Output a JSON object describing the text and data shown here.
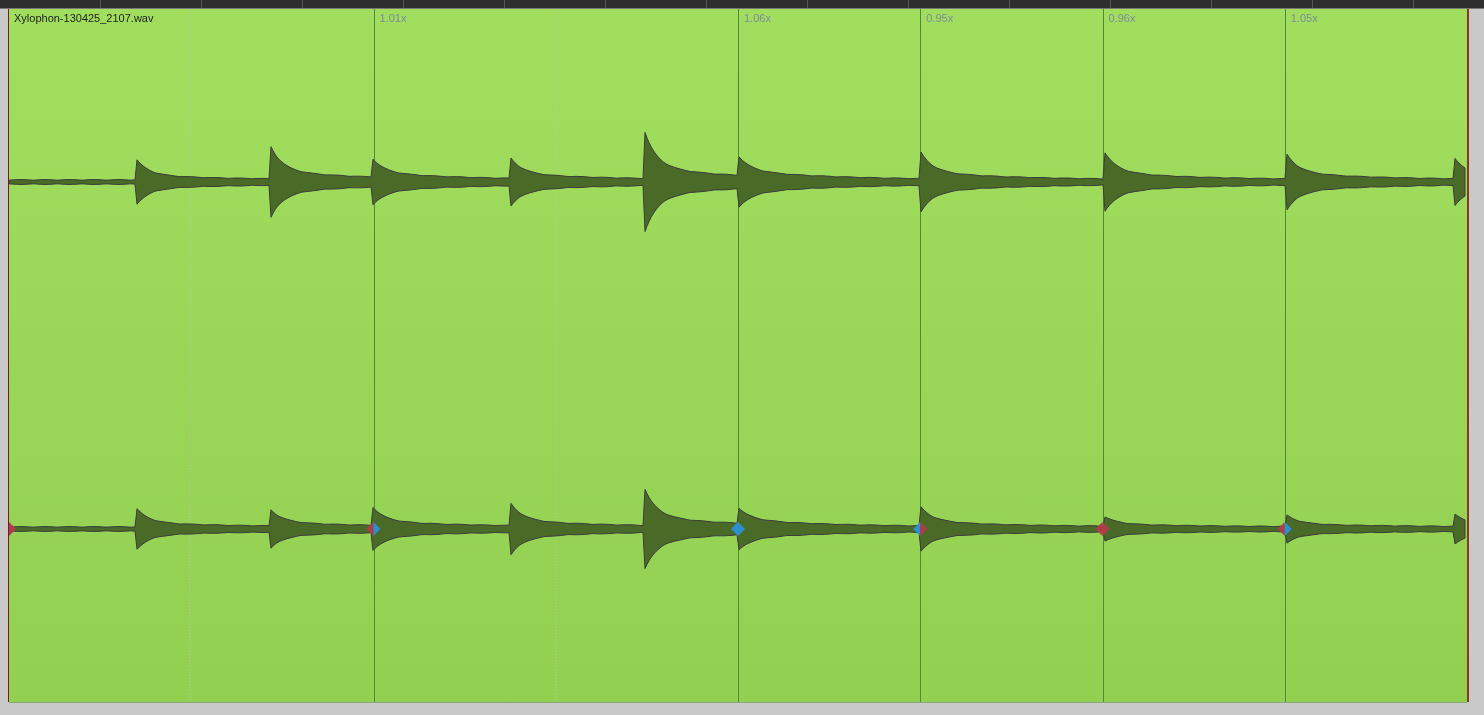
{
  "item": {
    "title": "Xylophon-130425_2107.wav"
  },
  "segments": [
    {
      "marker": {
        "right": {
          "color": "#b03c4a"
        }
      }
    },
    {
      "label": "1.01x",
      "marker": {
        "left": {
          "color": "#b03c4a"
        },
        "right": {
          "color": "#2e8fd0"
        }
      }
    },
    {
      "label": "1.06x",
      "marker": {
        "left": {
          "color": "#2e8fd0"
        },
        "right": {
          "color": "#2e8fd0"
        }
      }
    },
    {
      "label": "0.95x",
      "marker": {
        "left": {
          "color": "#2e8fd0"
        },
        "right": {
          "color": "#b03c4a"
        }
      }
    },
    {
      "label": "0.96x",
      "marker": {
        "left": {
          "color": "#b03c4a"
        },
        "right": {
          "color": "#b03c4a"
        }
      }
    },
    {
      "label": "1.05x",
      "marker": {
        "left": {
          "color": "#b03c4a"
        },
        "right": {
          "color": "#2e8fd0"
        }
      }
    }
  ]
}
